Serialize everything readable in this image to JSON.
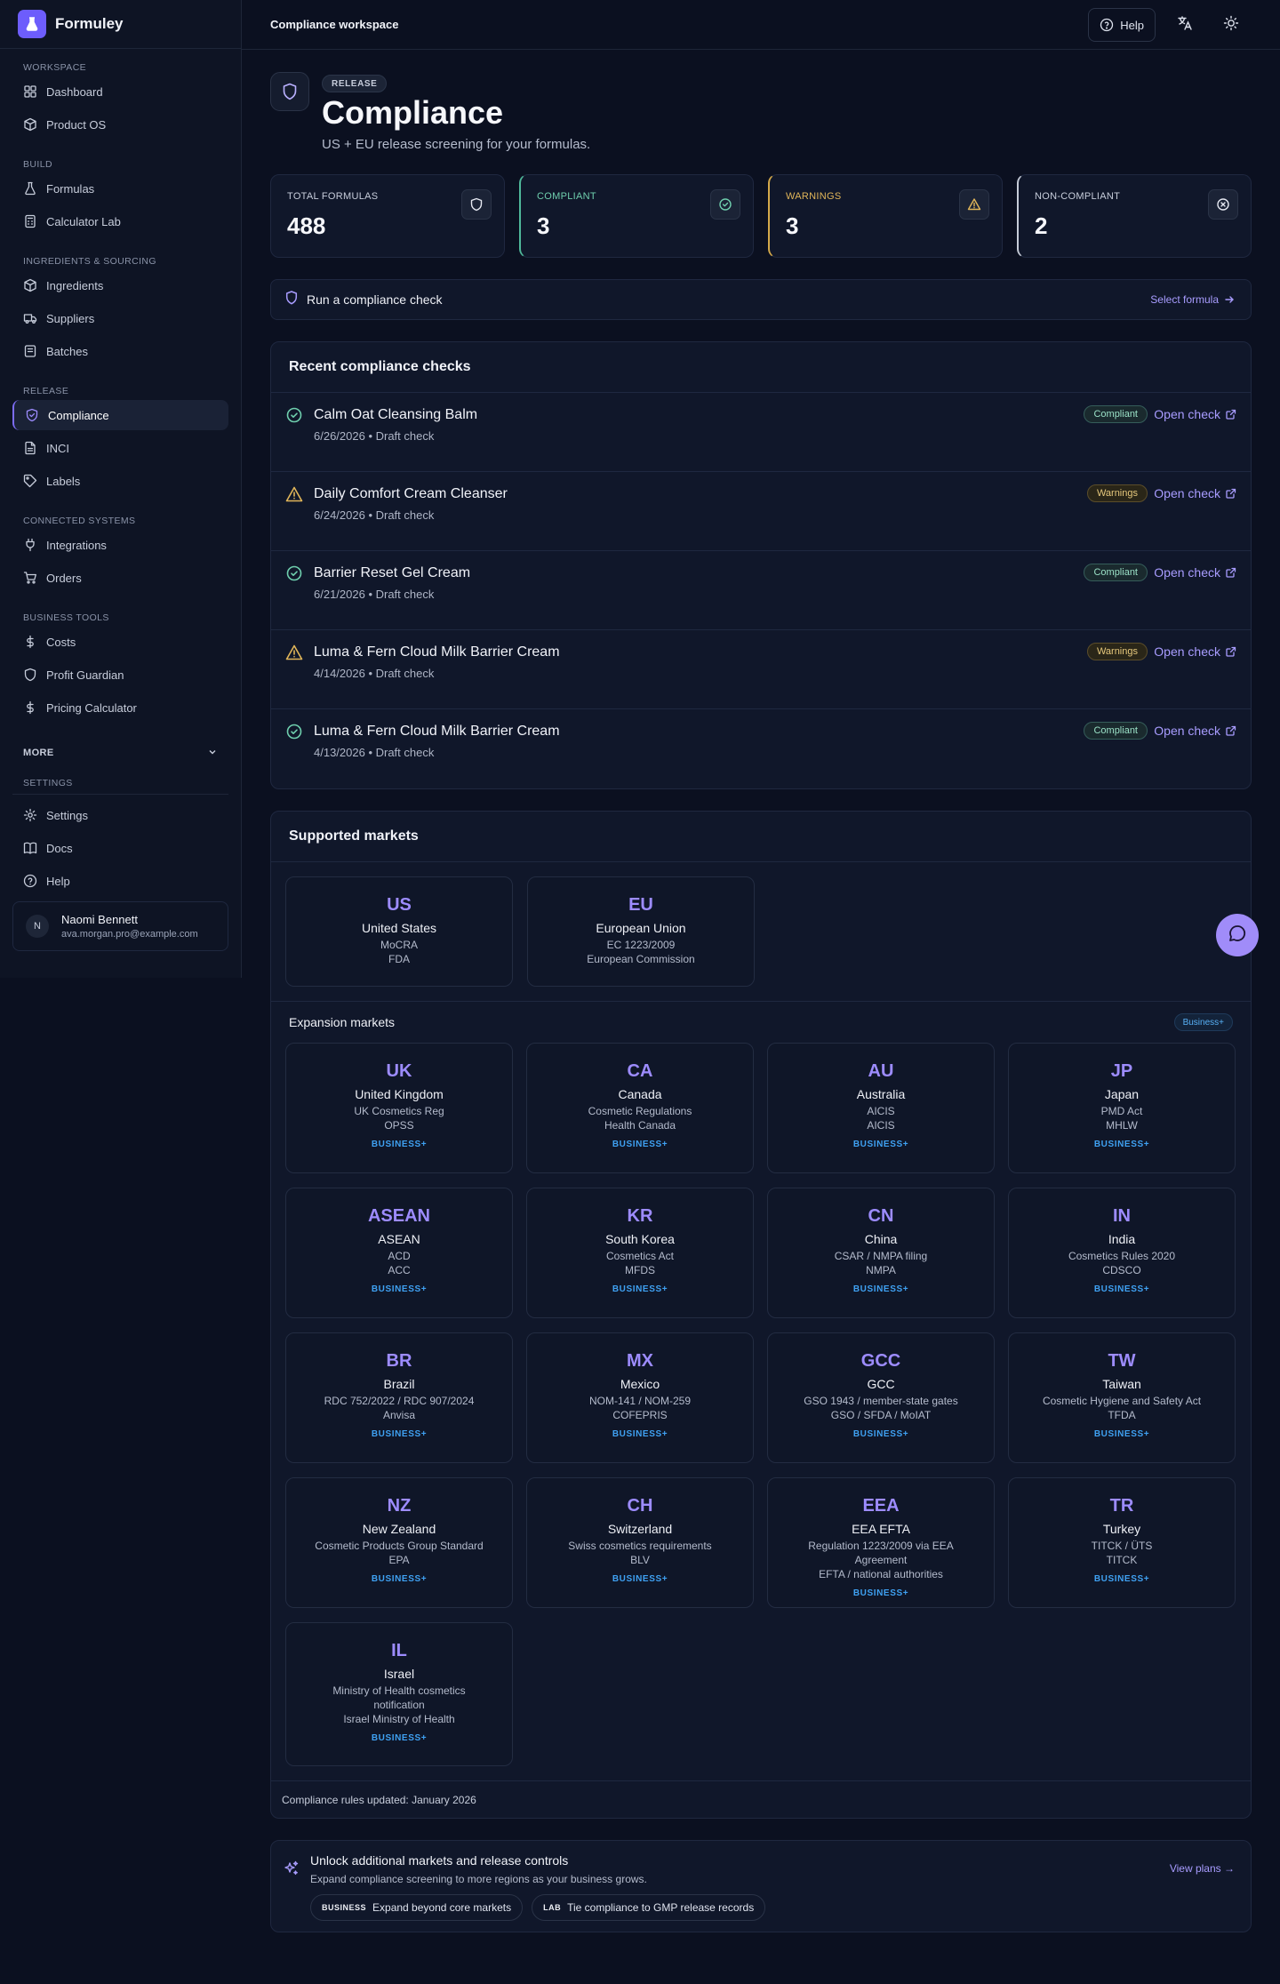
{
  "app": {
    "name": "Formuley"
  },
  "sidebar": {
    "sections": [
      {
        "title": "WORKSPACE",
        "items": [
          {
            "label": "Dashboard",
            "icon": "grid-icon"
          },
          {
            "label": "Product OS",
            "icon": "box-icon"
          }
        ]
      },
      {
        "title": "BUILD",
        "items": [
          {
            "label": "Formulas",
            "icon": "flask-icon"
          },
          {
            "label": "Calculator Lab",
            "icon": "calculator-icon"
          }
        ]
      },
      {
        "title": "INGREDIENTS & SOURCING",
        "items": [
          {
            "label": "Ingredients",
            "icon": "box-icon"
          },
          {
            "label": "Suppliers",
            "icon": "truck-icon"
          },
          {
            "label": "Batches",
            "icon": "package-icon"
          }
        ]
      },
      {
        "title": "RELEASE",
        "items": [
          {
            "label": "Compliance",
            "icon": "shield-check-icon",
            "active": true
          },
          {
            "label": "INCI",
            "icon": "file-text-icon"
          },
          {
            "label": "Labels",
            "icon": "tag-icon"
          }
        ]
      },
      {
        "title": "CONNECTED SYSTEMS",
        "items": [
          {
            "label": "Integrations",
            "icon": "plug-icon"
          },
          {
            "label": "Orders",
            "icon": "cart-icon"
          }
        ]
      },
      {
        "title": "BUSINESS TOOLS",
        "items": [
          {
            "label": "Costs",
            "icon": "dollar-icon"
          },
          {
            "label": "Profit Guardian",
            "icon": "shield-icon"
          },
          {
            "label": "Pricing Calculator",
            "icon": "dollar-icon"
          }
        ]
      }
    ],
    "more_label": "MORE",
    "settings_title": "SETTINGS",
    "settings_items": [
      {
        "label": "Settings",
        "icon": "gear-icon"
      },
      {
        "label": "Docs",
        "icon": "book-icon"
      },
      {
        "label": "Help",
        "icon": "help-circle-icon"
      }
    ],
    "user": {
      "initial": "N",
      "name": "Naomi Bennett",
      "email": "ava.morgan.pro@example.com"
    }
  },
  "topbar": {
    "title": "Compliance workspace",
    "help_label": "Help"
  },
  "hero": {
    "badge": "RELEASE",
    "title": "Compliance",
    "subtitle": "US + EU release screening for your formulas."
  },
  "stats": [
    {
      "label": "TOTAL FORMULAS",
      "value": "488",
      "kind": "total"
    },
    {
      "label": "COMPLIANT",
      "value": "3",
      "kind": "compliant"
    },
    {
      "label": "WARNINGS",
      "value": "3",
      "kind": "warnings"
    },
    {
      "label": "NON-COMPLIANT",
      "value": "2",
      "kind": "noncompliant"
    }
  ],
  "run_check": {
    "label": "Run a compliance check",
    "link": "Select formula"
  },
  "recent": {
    "title": "Recent compliance checks",
    "open_label": "Open check",
    "rows": [
      {
        "name": "Calm Oat Cleansing Balm",
        "meta": "6/26/2026 • Draft check",
        "status": "Compliant",
        "kind": "ok"
      },
      {
        "name": "Daily Comfort Cream Cleanser",
        "meta": "6/24/2026 • Draft check",
        "status": "Warnings",
        "kind": "warn"
      },
      {
        "name": "Barrier Reset Gel Cream",
        "meta": "6/21/2026 • Draft check",
        "status": "Compliant",
        "kind": "ok"
      },
      {
        "name": "Luma & Fern Cloud Milk Barrier Cream",
        "meta": "4/14/2026 • Draft check",
        "status": "Warnings",
        "kind": "warn"
      },
      {
        "name": "Luma & Fern Cloud Milk Barrier Cream",
        "meta": "4/13/2026 • Draft check",
        "status": "Compliant",
        "kind": "ok"
      }
    ]
  },
  "markets": {
    "title": "Supported markets",
    "supported": [
      {
        "code": "US",
        "name": "United States",
        "lines": [
          "MoCRA",
          "FDA"
        ]
      },
      {
        "code": "EU",
        "name": "European Union",
        "lines": [
          "EC 1223/2009",
          "European Commission"
        ]
      }
    ],
    "expansion_title": "Expansion markets",
    "expansion_badge": "Business+",
    "tier_label": "BUSINESS+",
    "expansion": [
      {
        "code": "UK",
        "name": "United Kingdom",
        "lines": [
          "UK Cosmetics Reg",
          "OPSS"
        ]
      },
      {
        "code": "CA",
        "name": "Canada",
        "lines": [
          "Cosmetic Regulations",
          "Health Canada"
        ]
      },
      {
        "code": "AU",
        "name": "Australia",
        "lines": [
          "AICIS",
          "AICIS"
        ]
      },
      {
        "code": "JP",
        "name": "Japan",
        "lines": [
          "PMD Act",
          "MHLW"
        ]
      },
      {
        "code": "ASEAN",
        "name": "ASEAN",
        "lines": [
          "ACD",
          "ACC"
        ]
      },
      {
        "code": "KR",
        "name": "South Korea",
        "lines": [
          "Cosmetics Act",
          "MFDS"
        ]
      },
      {
        "code": "CN",
        "name": "China",
        "lines": [
          "CSAR / NMPA filing",
          "NMPA"
        ]
      },
      {
        "code": "IN",
        "name": "India",
        "lines": [
          "Cosmetics Rules 2020",
          "CDSCO"
        ]
      },
      {
        "code": "BR",
        "name": "Brazil",
        "lines": [
          "RDC 752/2022 / RDC 907/2024",
          "Anvisa"
        ]
      },
      {
        "code": "MX",
        "name": "Mexico",
        "lines": [
          "NOM-141 / NOM-259",
          "COFEPRIS"
        ]
      },
      {
        "code": "GCC",
        "name": "GCC",
        "lines": [
          "GSO 1943 / member-state gates",
          "GSO / SFDA / MoIAT"
        ]
      },
      {
        "code": "TW",
        "name": "Taiwan",
        "lines": [
          "Cosmetic Hygiene and Safety Act",
          "TFDA"
        ]
      },
      {
        "code": "NZ",
        "name": "New Zealand",
        "lines": [
          "Cosmetic Products Group Standard",
          "EPA"
        ]
      },
      {
        "code": "CH",
        "name": "Switzerland",
        "lines": [
          "Swiss cosmetics requirements",
          "BLV"
        ]
      },
      {
        "code": "EEA",
        "name": "EEA EFTA",
        "lines": [
          "Regulation 1223/2009 via EEA",
          "Agreement",
          "EFTA / national authorities"
        ]
      },
      {
        "code": "TR",
        "name": "Turkey",
        "lines": [
          "TITCK / ÜTS",
          "TITCK"
        ]
      },
      {
        "code": "IL",
        "name": "Israel",
        "lines": [
          "Ministry of Health cosmetics",
          "notification",
          "Israel Ministry of Health"
        ]
      }
    ],
    "footer": "Compliance rules updated: January 2026"
  },
  "upsell": {
    "title": "Unlock additional markets and release controls",
    "subtitle": "Expand compliance screening to more regions as your business grows.",
    "link": "View plans",
    "chips": [
      {
        "tag": "BUSINESS",
        "label": "Expand beyond core markets"
      },
      {
        "tag": "LAB",
        "label": "Tie compliance to GMP release records"
      }
    ]
  },
  "colors": {
    "accent": "#6d5dfc",
    "link": "#a89cff",
    "compliant": "#4fb89a",
    "warning": "#d4a94a",
    "tier": "#3fa1f2"
  }
}
